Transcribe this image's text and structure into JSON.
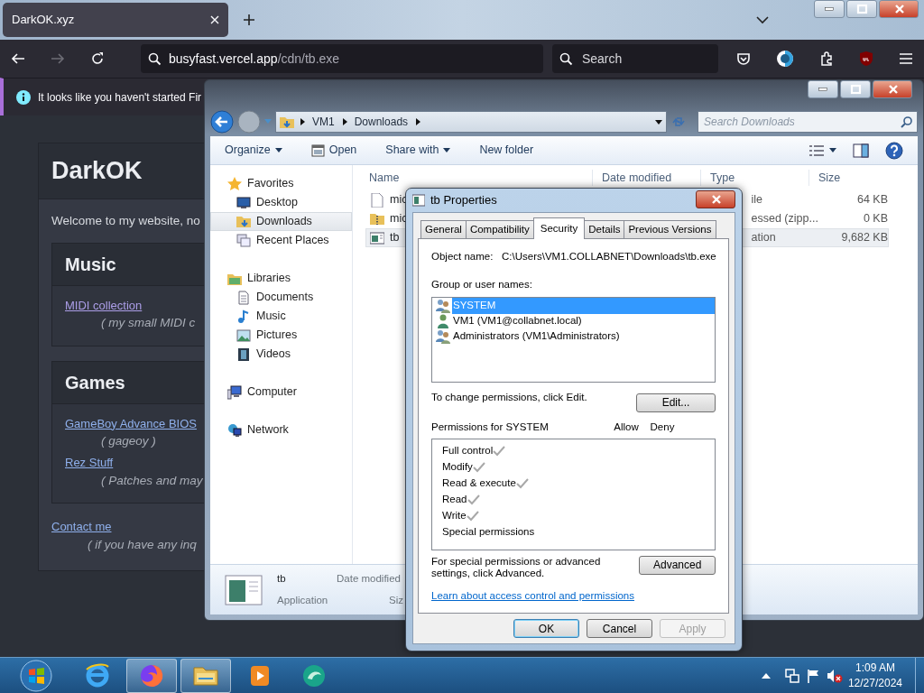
{
  "browser": {
    "tabs": [
      {
        "label": "DarkOK.xyz",
        "selected": true
      }
    ],
    "url_host": "busyfast.vercel.app",
    "url_path": "/cdn/tb.exe",
    "search_placeholder": "Search",
    "notification": "It looks like you haven't started Fir"
  },
  "website": {
    "title": "DarkOK",
    "welcome": "Welcome to my website, no",
    "sections": [
      {
        "heading": "Music",
        "links": [
          {
            "label": "MIDI collection",
            "visited": true,
            "note": "( my small MIDI c"
          }
        ]
      },
      {
        "heading": "Games",
        "links": [
          {
            "label": "GameBoy Advance BIOS",
            "visited": false,
            "note": "( gageoy )"
          },
          {
            "label": "Rez Stuff",
            "visited": false,
            "note": "( Patches and may"
          }
        ]
      }
    ],
    "contact": {
      "label": "Contact me",
      "note": "( if you have any inq"
    }
  },
  "explorer": {
    "breadcrumb": [
      "VM1",
      "Downloads"
    ],
    "search_placeholder": "Search Downloads",
    "toolbar": [
      {
        "label": "Organize",
        "kind": "menu"
      },
      {
        "label": "Open",
        "kind": "icon"
      },
      {
        "label": "Share with",
        "kind": "menu"
      },
      {
        "label": "New folder",
        "kind": "plain"
      }
    ],
    "nav": [
      {
        "label": "Favorites",
        "selected": false,
        "children": [
          {
            "label": "Desktop",
            "selected": false
          },
          {
            "label": "Downloads",
            "selected": true
          },
          {
            "label": "Recent Places",
            "selected": false
          }
        ]
      },
      {
        "label": "Libraries",
        "selected": false,
        "children": [
          {
            "label": "Documents",
            "selected": false
          },
          {
            "label": "Music",
            "selected": false
          },
          {
            "label": "Pictures",
            "selected": false
          },
          {
            "label": "Videos",
            "selected": false
          }
        ]
      },
      {
        "label": "Computer",
        "selected": false
      },
      {
        "label": "Network",
        "selected": false
      }
    ],
    "columns": [
      "Name",
      "Date modified",
      "Type",
      "Size"
    ],
    "files": [
      {
        "name": "mic",
        "type": "ile",
        "size": "64 KB",
        "kind": "file",
        "selected": false
      },
      {
        "name": "mic",
        "type": "essed (zipp...",
        "size": "0 KB",
        "kind": "zip",
        "selected": false
      },
      {
        "name": "tb",
        "type": "ation",
        "size": "9,682 KB",
        "kind": "app",
        "selected": true
      }
    ],
    "details": {
      "name": "tb",
      "type": "Application",
      "date_label": "Date modified",
      "size_label": "Siz"
    }
  },
  "dialog": {
    "title": "tb Properties",
    "tabs": [
      {
        "label": "General",
        "selected": false
      },
      {
        "label": "Compatibility",
        "selected": false
      },
      {
        "label": "Security",
        "selected": true
      },
      {
        "label": "Details",
        "selected": false
      },
      {
        "label": "Previous Versions",
        "selected": false
      }
    ],
    "object_label": "Object name:",
    "object_value": "C:\\Users\\VM1.COLLABNET\\Downloads\\tb.exe",
    "group_label": "Group or user names:",
    "users": [
      {
        "name": "SYSTEM",
        "kind": "group",
        "selected": true
      },
      {
        "name": "VM1 (VM1@collabnet.local)",
        "kind": "user",
        "selected": false
      },
      {
        "name": "Administrators (VM1\\Administrators)",
        "kind": "group",
        "selected": false
      }
    ],
    "change_text": "To change permissions, click Edit.",
    "edit_button": "Edit...",
    "permissions_label": "Permissions for SYSTEM",
    "allow_label": "Allow",
    "deny_label": "Deny",
    "permissions": [
      {
        "name": "Full control",
        "allow": true,
        "deny": false
      },
      {
        "name": "Modify",
        "allow": true,
        "deny": false
      },
      {
        "name": "Read & execute",
        "allow": true,
        "deny": false
      },
      {
        "name": "Read",
        "allow": true,
        "deny": false
      },
      {
        "name": "Write",
        "allow": true,
        "deny": false
      },
      {
        "name": "Special permissions",
        "allow": false,
        "deny": false
      }
    ],
    "advanced_text": "For special permissions or advanced settings, click Advanced.",
    "advanced_button": "Advanced",
    "link": "Learn about access control and permissions",
    "buttons": [
      {
        "label": "OK",
        "default": true,
        "disabled": false
      },
      {
        "label": "Cancel",
        "default": false,
        "disabled": false
      },
      {
        "label": "Apply",
        "default": false,
        "disabled": true
      }
    ]
  },
  "taskbar": {
    "apps": [
      {
        "active": false
      },
      {
        "active": true
      },
      {
        "active": true
      },
      {
        "active": false
      },
      {
        "active": false
      }
    ],
    "time": "1:09 AM",
    "date": "12/27/2024"
  }
}
